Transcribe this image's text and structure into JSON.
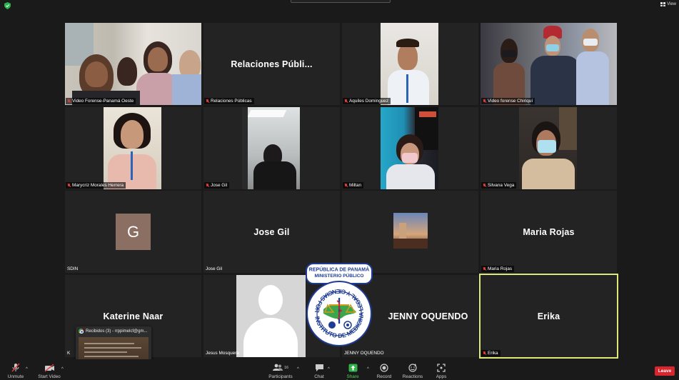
{
  "topbar": {
    "view_label": "View"
  },
  "tiles": [
    {
      "id": "video-forense-panama-oeste",
      "label": "Video Forense-Panamá Oeste",
      "big_name": ""
    },
    {
      "id": "relaciones-publicas",
      "label": "Relaciones Públicas",
      "big_name": "Relaciones  Públi..."
    },
    {
      "id": "aquiles-dominguez",
      "label": "Aquiles Dominguez",
      "big_name": ""
    },
    {
      "id": "video-forense-chiriqui",
      "label": "Video forense Chiriquí",
      "big_name": ""
    },
    {
      "id": "marycriz-morales-herrera",
      "label": "Marycriz Morales Herrera",
      "big_name": ""
    },
    {
      "id": "jose-gil-video",
      "label": "Jose Gil",
      "big_name": ""
    },
    {
      "id": "miltan",
      "label": "Miltan",
      "big_name": ""
    },
    {
      "id": "silvana-vega",
      "label": "Silvana Vega",
      "big_name": ""
    },
    {
      "id": "sdin",
      "label": "SDIN",
      "big_name": "",
      "avatar_letter": "G"
    },
    {
      "id": "jose-gil",
      "label": "Jose Gil",
      "big_name": "Jose Gil"
    },
    {
      "id": "photo-avatar",
      "label": "",
      "big_name": ""
    },
    {
      "id": "maria-rojas",
      "label": "Maria Rojas",
      "big_name": "Maria Rojas"
    },
    {
      "id": "katerine-naar",
      "label": "K",
      "big_name": "Katerine Naar"
    },
    {
      "id": "jesus-mosquera",
      "label": "Jesus Mosquera",
      "big_name": ""
    },
    {
      "id": "jenny-oquendo",
      "label": "JENNY OQUENDO",
      "big_name": "JENNY OQUENDO"
    },
    {
      "id": "erika",
      "label": "Erika",
      "big_name": "Erika"
    }
  ],
  "emblem": {
    "top_line1": "REPÚBLICA DE PANAMÁ",
    "top_line2": "MINISTERIO PÚBLICO",
    "ring_text": "INSTITUTO DE MEDICINA LEGAL Y CIENCIAS FORENSES -"
  },
  "taskbar_preview": {
    "title": "Recibidos (3) - rrppimelcf@gm..."
  },
  "toolbar": {
    "unmute": "Unmute",
    "start_video": "Start Video",
    "participants": "Participants",
    "participants_count": "16",
    "chat": "Chat",
    "share_screen": "Share Screen",
    "record": "Record",
    "reactions": "Reactions",
    "apps": "Apps",
    "leave": "Leave"
  },
  "colors": {
    "active_speaker_border": "#dfe87a",
    "leave_red": "#d9252e",
    "share_green": "#4fd35a",
    "mute_red": "#e23b3b"
  }
}
